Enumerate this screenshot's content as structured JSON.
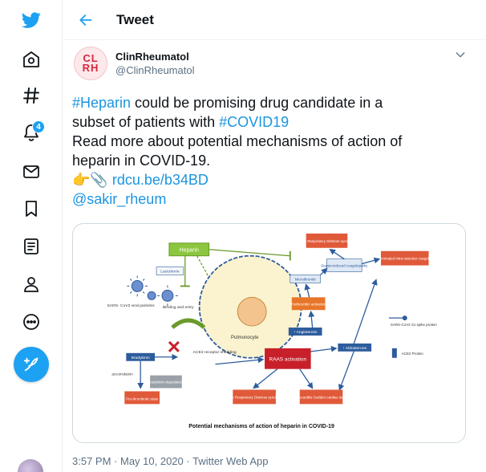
{
  "header": {
    "title": "Tweet"
  },
  "nav": {
    "notifications_count": "4",
    "items": [
      "twitter-logo",
      "home",
      "explore",
      "notifications",
      "messages",
      "bookmarks",
      "lists",
      "profile",
      "more",
      "compose"
    ]
  },
  "tweet": {
    "avatar_text_top": "CL",
    "avatar_text_bottom": "RH",
    "display_name": "ClinRheumatol",
    "handle": "@ClinRheumatol",
    "line1_tag": "#Heparin",
    "line1_rest": " could be promising drug candidate in a",
    "line2_text": "subset of patients with ",
    "line2_tag": "#COVID19",
    "line3": "Read more about potential mechanisms of action of",
    "line4": "heparin in COVID-19.",
    "line5_emoji": "👉📎 ",
    "line5_link": "rdcu.be/b34BD",
    "line6_mention": "@sakir_rheum",
    "time": "3:57 PM",
    "sep1": " · ",
    "date": "May 10, 2020",
    "sep2": " · ",
    "source": "Twitter Web App"
  },
  "figure": {
    "heparin": "Heparin",
    "lactoferrin": "Lactoferrin",
    "sars_viral": "SARS- CoV2 viral particles",
    "binding": "Binding and entry",
    "pulmonocyte": "Pulmonocyte",
    "ace2_shedding": "ACE2 receptor shedding",
    "bradykinin": "Bradykinin",
    "accumulation": "accumulation",
    "bradykinin_degradation": "Bradykinin degradation",
    "prothrombotic": "Pro-thrombotic state",
    "raas": "RAAS activation",
    "angiotensin": "↑ Angiotensin",
    "aldosterone": "↑ Aldosterone",
    "prothrombin": "Prothrombin activation",
    "microthrombi": "Microthrombi",
    "sepsis": "Sepsis-induced coagulopathy",
    "ards_top": "Acute Respiratory Distress syndrome",
    "dic": "Disseminated intra-vascular coagulation",
    "ards_bottom": "Acute Respiratory Distress syndrome",
    "myocarditis": "Myocarditis Sudden cardiac death",
    "spike_legend": "SARS-CoV2 S1 spike protein",
    "ace2_legend": "ACE2 Protein",
    "caption": "Potential mechanisms of action of heparin in COVID-19"
  },
  "colors": {
    "accent": "#1da1f2",
    "link": "#1b95e0",
    "box_red": "#e05a3a",
    "box_dark_red": "#c8202a",
    "box_green": "#8cc63f",
    "box_blue": "#2d5c9c"
  }
}
